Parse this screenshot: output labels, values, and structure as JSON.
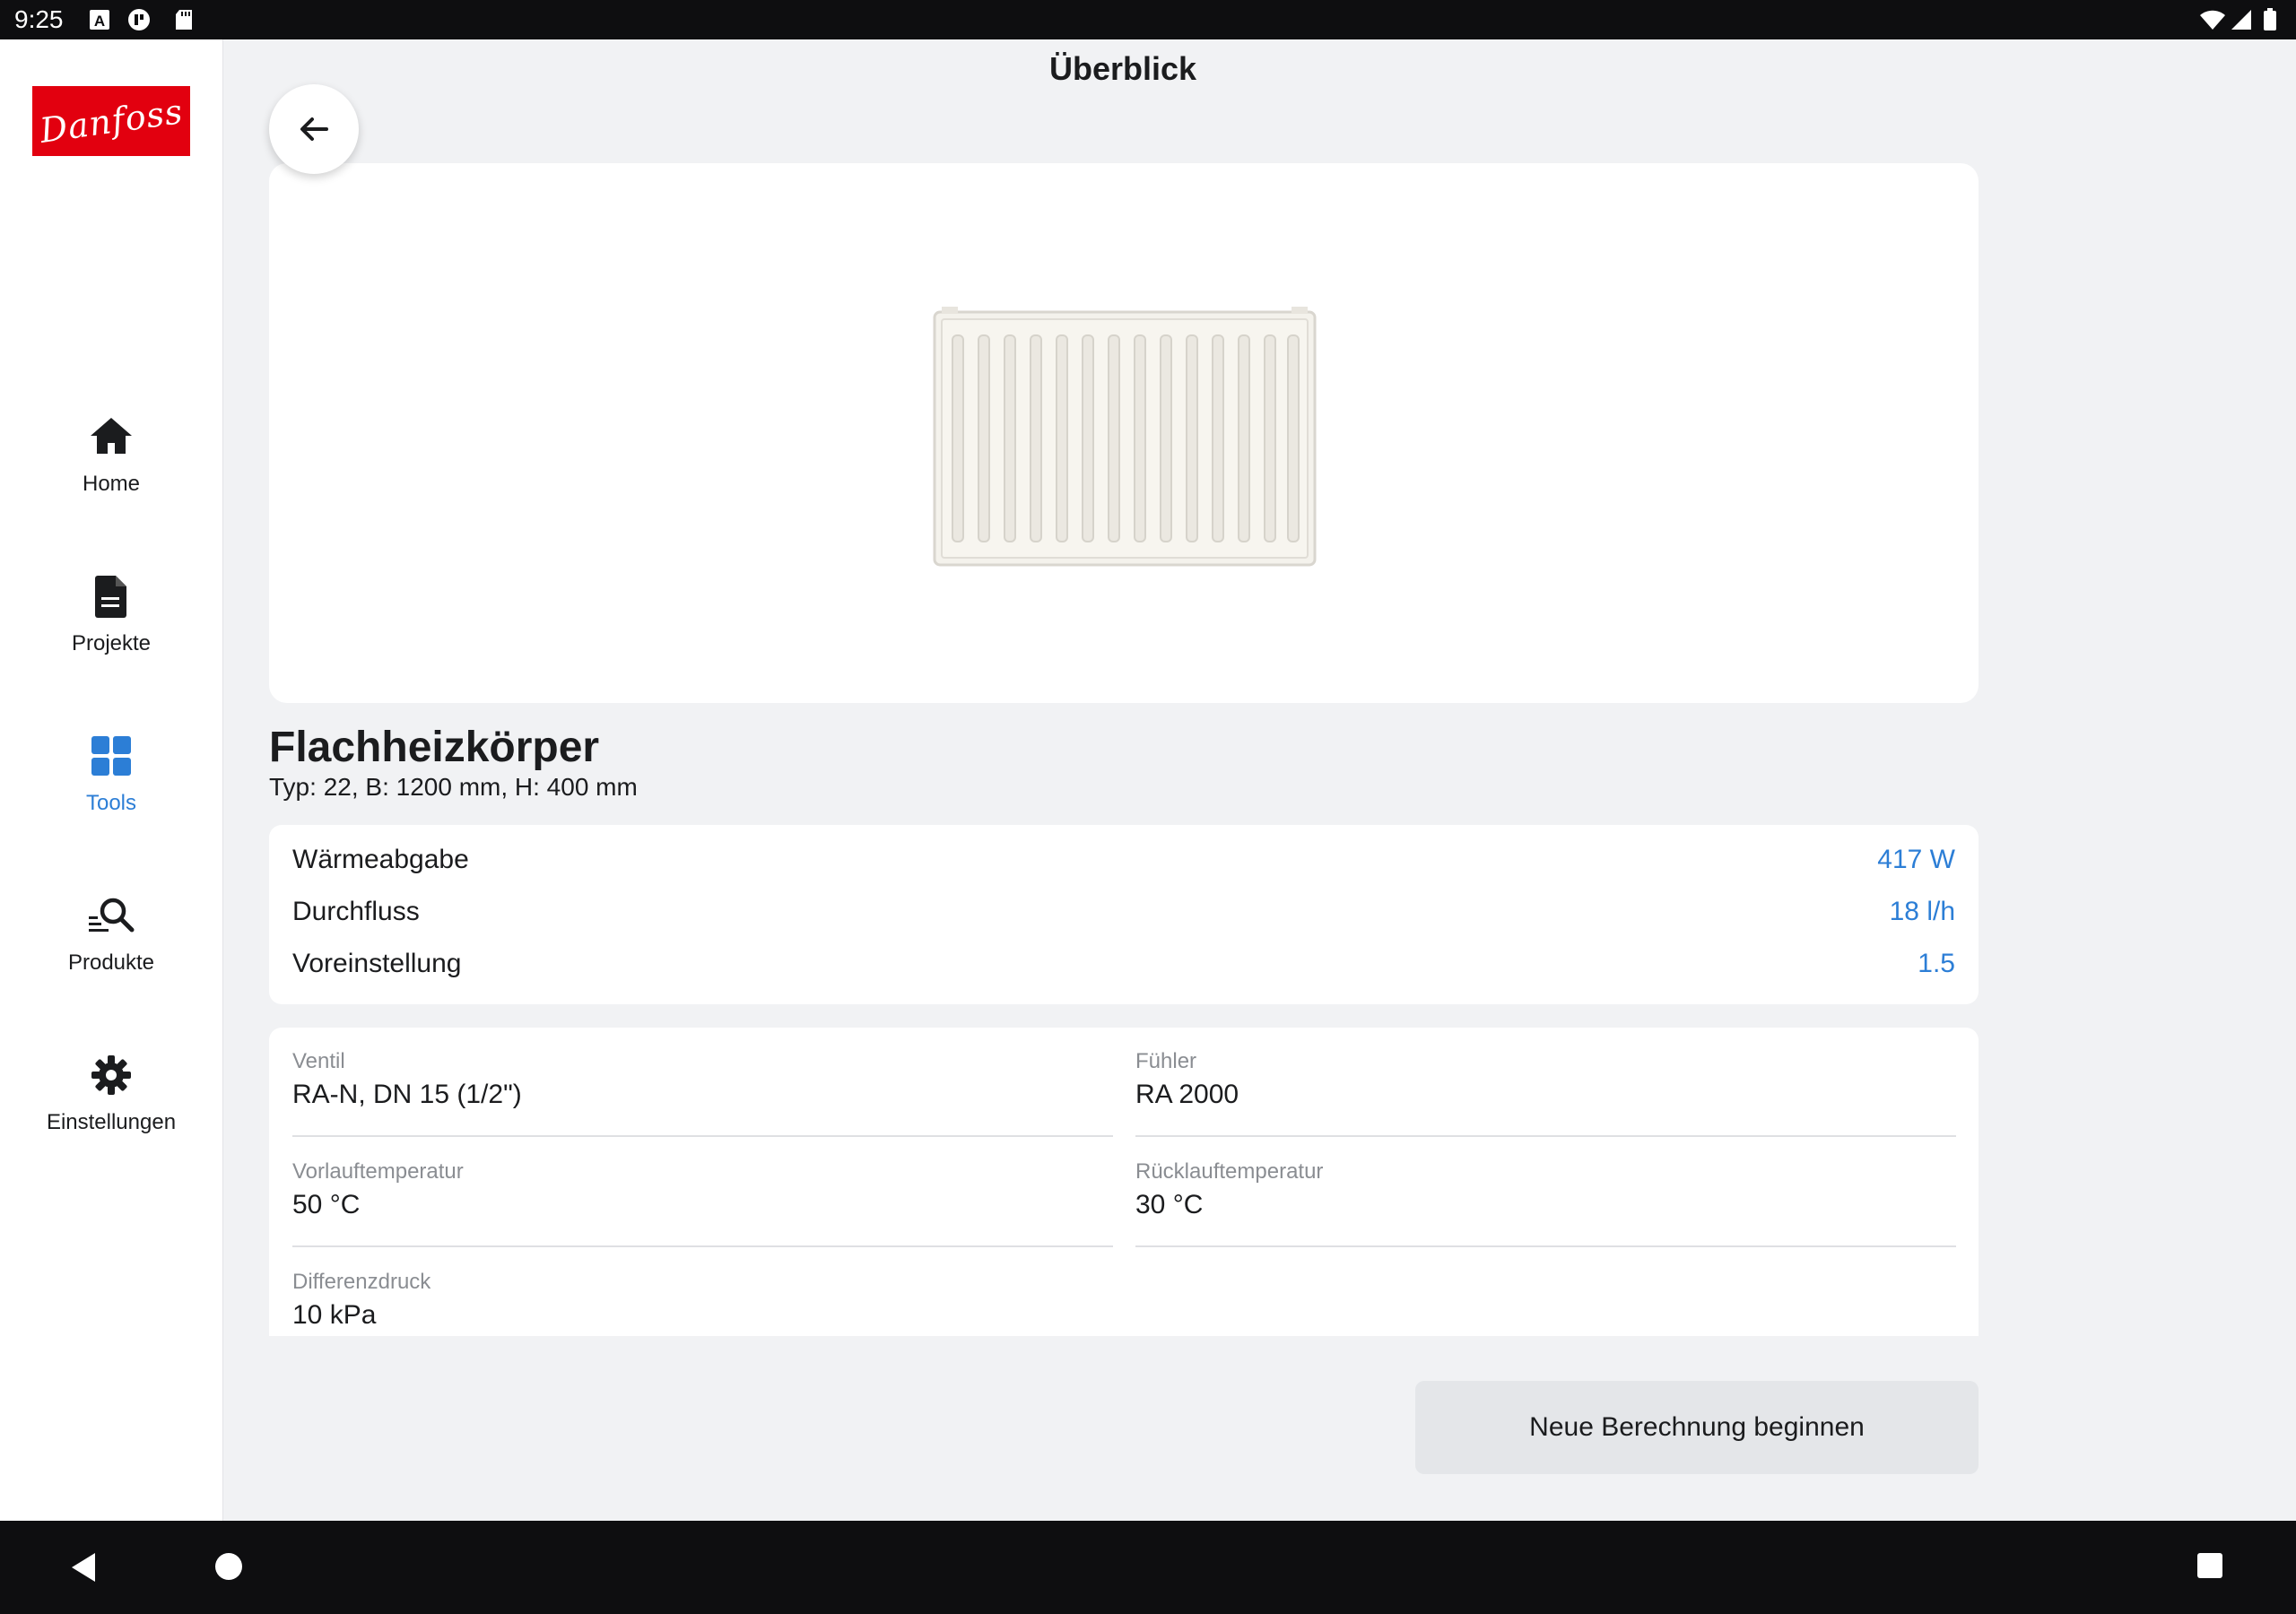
{
  "status_bar": {
    "time": "9:25"
  },
  "brand": {
    "logo_text": "Danfoss",
    "accent": "#e2000f"
  },
  "sidebar": {
    "items": [
      {
        "label": "Home",
        "icon": "home-icon",
        "active": false
      },
      {
        "label": "Projekte",
        "icon": "document-icon",
        "active": false
      },
      {
        "label": "Tools",
        "icon": "grid-icon",
        "active": true
      },
      {
        "label": "Produkte",
        "icon": "search-list-icon",
        "active": false
      },
      {
        "label": "Einstellungen",
        "icon": "gear-icon",
        "active": false
      }
    ]
  },
  "header": {
    "title": "Überblick"
  },
  "product": {
    "name": "Flachheizkörper",
    "subtitle": "Typ: 22, B: 1200 mm, H: 400 mm"
  },
  "results": [
    {
      "label": "Wärmeabgabe",
      "value": "417 W"
    },
    {
      "label": "Durchfluss",
      "value": "18 l/h"
    },
    {
      "label": "Voreinstellung",
      "value": "1.5"
    }
  ],
  "params": {
    "ventil": {
      "label": "Ventil",
      "value": "RA-N, DN 15 (1/2\")"
    },
    "fuehler": {
      "label": "Fühler",
      "value": "RA 2000"
    },
    "vorlauf": {
      "label": "Vorlauftemperatur",
      "value": "50 °C"
    },
    "ruecklauf": {
      "label": "Rücklauftemperatur",
      "value": "30 °C"
    },
    "differenzdruck": {
      "label": "Differenzdruck",
      "value": "10 kPa"
    }
  },
  "actions": {
    "new_calc_label": "Neue Berechnung beginnen"
  },
  "colors": {
    "accent_blue": "#2c7ed6",
    "background": "#f1f2f4"
  }
}
